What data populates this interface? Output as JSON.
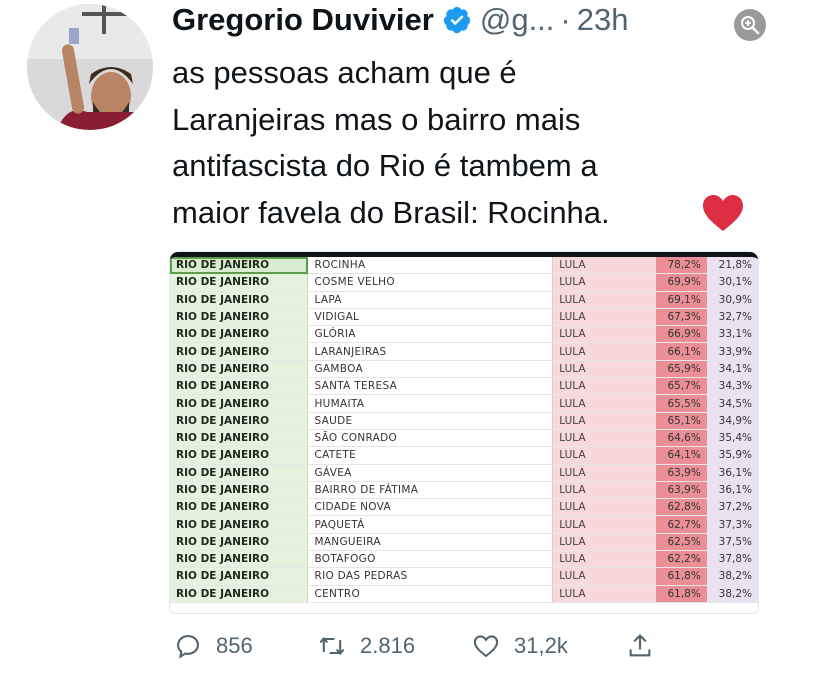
{
  "author": {
    "name": "Gregorio Duvivier",
    "handle": "@g...",
    "time": "23h"
  },
  "tweet": {
    "text": "as pessoas acham que é\nLaranjeiras mas o bairro mais\nantifascista do Rio é tambem a\nmaior favela do Brasil: Rocinha."
  },
  "table": {
    "rows": [
      {
        "state": "RIO DE JANEIRO",
        "bairro": "ROCINHA",
        "cand": "LULA",
        "p1": "78,2%",
        "p2": "21,8%"
      },
      {
        "state": "RIO DE JANEIRO",
        "bairro": "COSME VELHO",
        "cand": "LULA",
        "p1": "69,9%",
        "p2": "30,1%"
      },
      {
        "state": "RIO DE JANEIRO",
        "bairro": "LAPA",
        "cand": "LULA",
        "p1": "69,1%",
        "p2": "30,9%"
      },
      {
        "state": "RIO DE JANEIRO",
        "bairro": "VIDIGAL",
        "cand": "LULA",
        "p1": "67,3%",
        "p2": "32,7%"
      },
      {
        "state": "RIO DE JANEIRO",
        "bairro": "GLÓRIA",
        "cand": "LULA",
        "p1": "66,9%",
        "p2": "33,1%"
      },
      {
        "state": "RIO DE JANEIRO",
        "bairro": "LARANJEIRAS",
        "cand": "LULA",
        "p1": "66,1%",
        "p2": "33,9%"
      },
      {
        "state": "RIO DE JANEIRO",
        "bairro": "GAMBOA",
        "cand": "LULA",
        "p1": "65,9%",
        "p2": "34,1%"
      },
      {
        "state": "RIO DE JANEIRO",
        "bairro": "SANTA TERESA",
        "cand": "LULA",
        "p1": "65,7%",
        "p2": "34,3%"
      },
      {
        "state": "RIO DE JANEIRO",
        "bairro": "HUMAITA",
        "cand": "LULA",
        "p1": "65,5%",
        "p2": "34,5%"
      },
      {
        "state": "RIO DE JANEIRO",
        "bairro": "SAUDE",
        "cand": "LULA",
        "p1": "65,1%",
        "p2": "34,9%"
      },
      {
        "state": "RIO DE JANEIRO",
        "bairro": "SÃO CONRADO",
        "cand": "LULA",
        "p1": "64,6%",
        "p2": "35,4%"
      },
      {
        "state": "RIO DE JANEIRO",
        "bairro": "CATETE",
        "cand": "LULA",
        "p1": "64,1%",
        "p2": "35,9%"
      },
      {
        "state": "RIO DE JANEIRO",
        "bairro": "GÁVEA",
        "cand": "LULA",
        "p1": "63,9%",
        "p2": "36,1%"
      },
      {
        "state": "RIO DE JANEIRO",
        "bairro": "BAIRRO DE FÁTIMA",
        "cand": "LULA",
        "p1": "63,9%",
        "p2": "36,1%"
      },
      {
        "state": "RIO DE JANEIRO",
        "bairro": "CIDADE NOVA",
        "cand": "LULA",
        "p1": "62,8%",
        "p2": "37,2%"
      },
      {
        "state": "RIO DE JANEIRO",
        "bairro": "PAQUETÁ",
        "cand": "LULA",
        "p1": "62,7%",
        "p2": "37,3%"
      },
      {
        "state": "RIO DE JANEIRO",
        "bairro": "MANGUEIRA",
        "cand": "LULA",
        "p1": "62,5%",
        "p2": "37,5%"
      },
      {
        "state": "RIO DE JANEIRO",
        "bairro": "BOTAFOGO",
        "cand": "LULA",
        "p1": "62,2%",
        "p2": "37,8%"
      },
      {
        "state": "RIO DE JANEIRO",
        "bairro": "RIO DAS PEDRAS",
        "cand": "LULA",
        "p1": "61,8%",
        "p2": "38,2%"
      },
      {
        "state": "RIO DE JANEIRO",
        "bairro": "CENTRO",
        "cand": "LULA",
        "p1": "61,8%",
        "p2": "38,2%"
      }
    ]
  },
  "actions": {
    "replies": "856",
    "retweets": "2.816",
    "likes": "31,2k"
  },
  "icons": {
    "verified": "verified-badge-icon",
    "zoom": "zoom-in-icon",
    "heart_emoji": "red-heart-emoji",
    "reply": "reply-icon",
    "retweet": "retweet-icon",
    "like": "like-icon",
    "share": "share-icon"
  },
  "colors": {
    "verified": "#1d9bf0",
    "text": "#0f1419",
    "muted": "#536471",
    "heart": "#e0245e"
  }
}
